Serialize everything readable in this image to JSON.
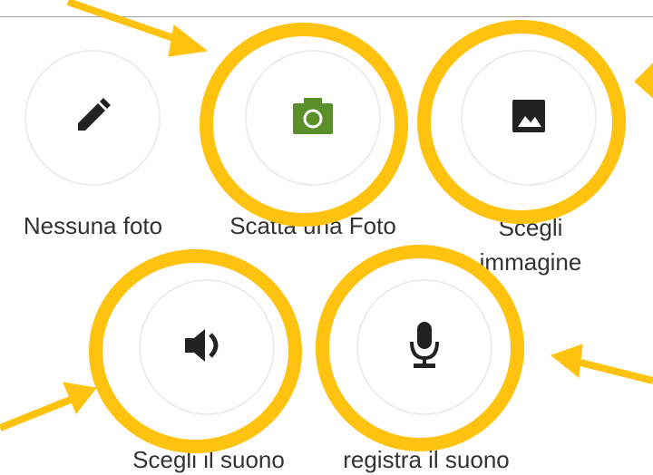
{
  "options": [
    {
      "id": "no-photo",
      "label": "Nessuna foto",
      "icon": "pencil-icon"
    },
    {
      "id": "take-photo",
      "label": "Scatta una Foto",
      "icon": "camera-icon",
      "icon_color": "#5a8f29"
    },
    {
      "id": "choose-image",
      "label": "Scegli immagine",
      "icon": "image-icon"
    },
    {
      "id": "choose-sound",
      "label": "Scegli il suono",
      "icon": "speaker-icon"
    },
    {
      "id": "record-sound",
      "label": "registra il suono",
      "icon": "microphone-icon"
    }
  ],
  "annotations": {
    "highlight_color": "#ffc20e",
    "highlight_shape": "circle",
    "pointer_icon": "arrow-icon"
  }
}
